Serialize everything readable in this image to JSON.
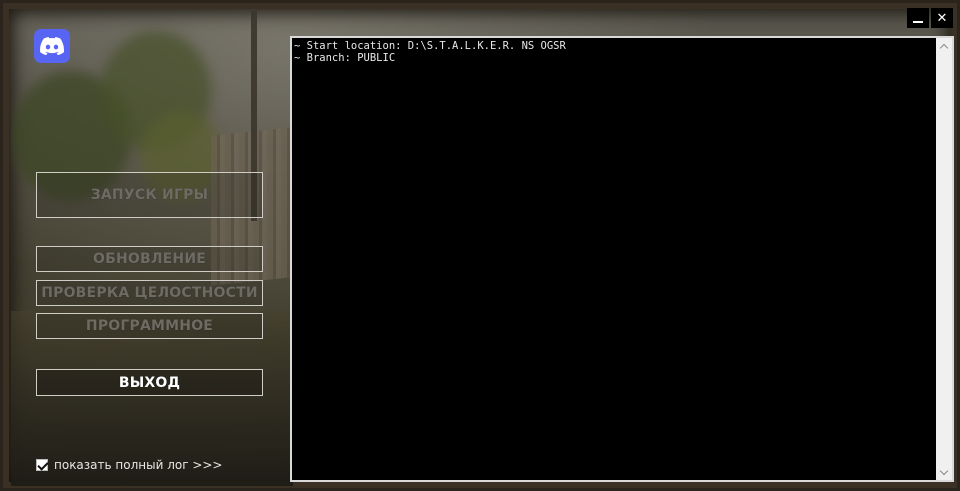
{
  "window": {
    "minimize_icon": "minimize-icon",
    "close_icon": "close-icon",
    "close_glyph": "✕"
  },
  "discord": {
    "icon": "discord-icon",
    "color": "#5865f2"
  },
  "menu": {
    "launch": "ЗАПУСК ИГРЫ",
    "update": "ОБНОВЛЕНИЕ",
    "verify": "ПРОВЕРКА ЦЕЛОСТНОСТИ",
    "software": "ПРОГРАММНОЕ",
    "exit": "ВЫХОД"
  },
  "log_toggle": {
    "label": "показать полный лог >>>",
    "checked": true
  },
  "console": {
    "line1": "~ Start location: D:\\S.T.A.L.K.E.R. NS OGSR",
    "line2": "~ Branch: PUBLIC"
  }
}
